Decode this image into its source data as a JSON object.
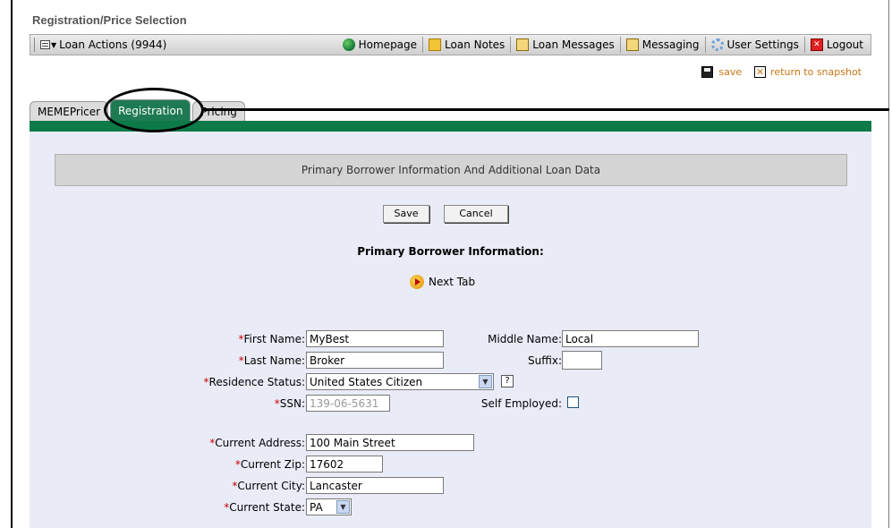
{
  "page_title": "Registration/Price Selection",
  "toolbar": {
    "loan_actions": "Loan Actions (9944)",
    "items": [
      {
        "label": "Homepage",
        "icon": "home-icon"
      },
      {
        "label": "Loan Notes",
        "icon": "notes-icon"
      },
      {
        "label": "Loan Messages",
        "icon": "envelope-icon"
      },
      {
        "label": "Messaging",
        "icon": "envelope-icon"
      },
      {
        "label": "User Settings",
        "icon": "gear-icon"
      },
      {
        "label": "Logout",
        "icon": "logout-icon"
      }
    ]
  },
  "actions": {
    "save": "save",
    "return": "return to snapshot"
  },
  "tabs": [
    {
      "label": "MEMEPricer"
    },
    {
      "label": "Registration",
      "active": true
    },
    {
      "label": "Pricing"
    }
  ],
  "section": {
    "header": "Primary Borrower Information And Additional Loan Data",
    "save_button": "Save",
    "cancel_button": "Cancel",
    "subtitle": "Primary Borrower Information:",
    "next_tab": "Next Tab"
  },
  "form": {
    "first_name": {
      "label": "First Name:",
      "value": "MyBest"
    },
    "middle_name": {
      "label": "Middle Name:",
      "value": "Local"
    },
    "last_name": {
      "label": "Last Name:",
      "value": "Broker"
    },
    "suffix": {
      "label": "Suffix:",
      "value": ""
    },
    "residence_status": {
      "label": "Residence Status:",
      "value": "United States Citizen",
      "help": "?"
    },
    "ssn": {
      "label": "SSN:",
      "value": "139-06-5631"
    },
    "self_employed": {
      "label": "Self Employed:",
      "checked": false
    },
    "current_address": {
      "label": "Current Address:",
      "value": "100 Main Street"
    },
    "current_zip": {
      "label": "Current Zip:",
      "value": "17602"
    },
    "current_city": {
      "label": "Current City:",
      "value": "Lancaster"
    },
    "current_state": {
      "label": "Current State:",
      "value": "PA"
    },
    "required_marker": "*"
  },
  "colors": {
    "green": "#0d7a48",
    "required": "#cc0000",
    "link_orange": "#c87614"
  }
}
